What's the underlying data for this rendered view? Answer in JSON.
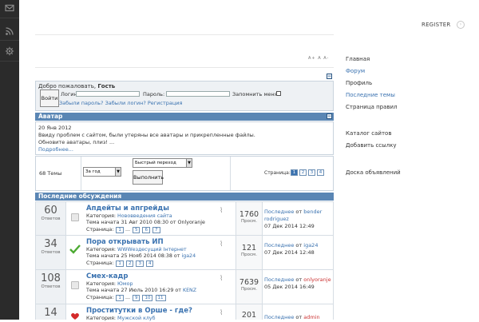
{
  "header": {
    "register_label": "REGISTER",
    "register_icon": "circle-arrow-icon",
    "font_sizes": "A+ A A-"
  },
  "rail_icons": [
    "mail-icon",
    "rss-icon",
    "settings-icon"
  ],
  "sidebar": {
    "items": [
      {
        "label": "Главная"
      },
      {
        "label": "Форум",
        "active": true
      },
      {
        "label": "Профиль"
      },
      {
        "label": "Последние темы",
        "active": true
      },
      {
        "label": "Страница правил"
      },
      {
        "label": "Каталог сайтов"
      },
      {
        "label": "Добавить ссылку"
      },
      {
        "label": "Доска объявлений"
      }
    ]
  },
  "welcome": {
    "greeting": "Добро пожаловать,",
    "guest": "Гость",
    "login_button": "Войти",
    "login_label": "Логин:",
    "password_label": "Пароль:",
    "remember_label": "Запомнить меня",
    "forgot": "Забыли пароль? Забыли логин? Регистрация"
  },
  "avatar": {
    "title": "Аватар",
    "date": "20 Янв 2012",
    "line1": "Ввиду проблем с сайтом, были утеряны все аватары и прикрепленные файлы.",
    "line2": "Обновите аватары, плиз! ...",
    "more": "Подробнее..."
  },
  "controls": {
    "topics_count": "68 Темы",
    "period_select": "За год",
    "jump_select": "Быстрый переход",
    "go_button": "Выполнить",
    "pages_label": "Страница:",
    "pages": [
      "1",
      "2",
      "3",
      "4"
    ],
    "current_page": "1"
  },
  "discussions": {
    "title": "Последние обсуждения",
    "answers_caption": "Ответов",
    "views_caption": "Просм.",
    "last_label": "Последнее",
    "from_label": "от",
    "category_label": "Категория:",
    "started_label": "Тема начата",
    "by_label": "от",
    "pages_label": "Страница:",
    "topics": [
      {
        "title": "Апдейты и апгрейды",
        "answers": "60",
        "category": "Нововведения сайта",
        "started": "31 Авг 2010 08:30",
        "starter": "Onlyoranje",
        "pages": [
          "1",
          "...",
          "5",
          "6",
          "7"
        ],
        "views": "1760",
        "last_user": "bender rodriguez",
        "last_date": "07 Дек 2014 12:49",
        "status_icon": "topic-icon"
      },
      {
        "title": "Пора открывать ИП",
        "answers": "34",
        "category": "WWWездесущий Інтернет",
        "started": "25 Нояб 2014 08:38",
        "starter": "iga24",
        "pages": [
          "1",
          "2",
          "3",
          "4"
        ],
        "views": "121",
        "last_user": "iga24",
        "last_date": "07 Дек 2014 12:48",
        "status_icon": "check-icon"
      },
      {
        "title": "Смех-кадр",
        "answers": "108",
        "category": "Юмор",
        "started": "27 Июль 2010 16:29",
        "starter": "KENZ",
        "pages": [
          "1",
          "...",
          "9",
          "10",
          "11"
        ],
        "views": "7639",
        "last_user": "onlyoranje",
        "last_date": "05 Дек 2014 16:49",
        "status_icon": "topic-icon"
      },
      {
        "title": "Проститутки в Орше - где?",
        "answers": "14",
        "category": "Мужской клуб",
        "started": "",
        "starter": "",
        "pages": [],
        "views": "201",
        "last_user": "admin",
        "last_date": "",
        "status_icon": "heart-icon"
      }
    ]
  }
}
